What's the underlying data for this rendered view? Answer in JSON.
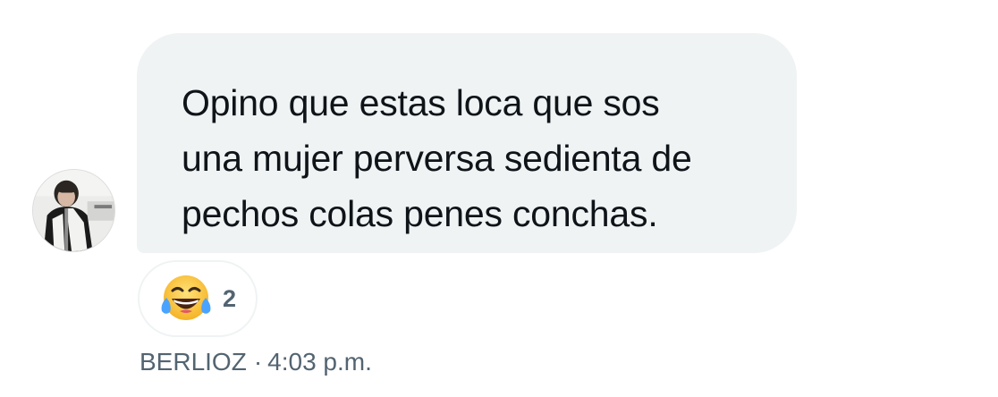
{
  "message": {
    "lines": [
      "Opino que estas loca que sos",
      "una mujer perversa sedienta de",
      "pechos colas penes conchas."
    ]
  },
  "reaction": {
    "emoji_icon": "face-with-tears-of-joy-icon",
    "count": "2"
  },
  "meta": {
    "sender": "BERLIOZ",
    "separator": "·",
    "time": "4:03 p.m."
  },
  "colors": {
    "bubble_bg": "#eff3f4",
    "text": "#0f1419",
    "secondary_text": "#536471"
  }
}
